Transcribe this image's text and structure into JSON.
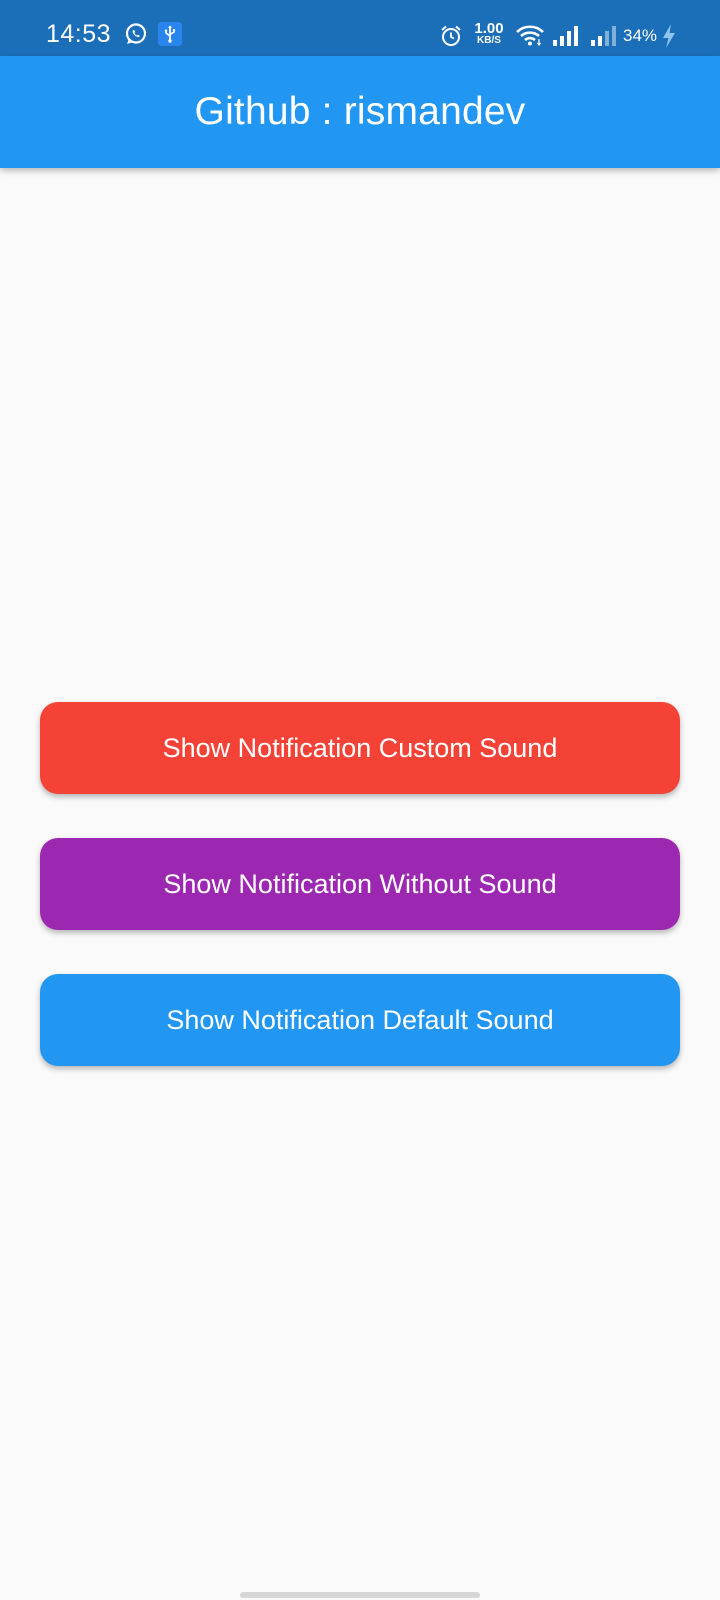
{
  "status_bar": {
    "time": "14:53",
    "speed_value": "1.00",
    "speed_unit": "KB/S",
    "battery": "34%",
    "icons": [
      "whatsapp-icon",
      "usb-icon",
      "alarm-icon",
      "wifi-icon",
      "signal-icon",
      "signal-icon",
      "charging-icon"
    ]
  },
  "app_bar": {
    "title": "Github : rismandev"
  },
  "buttons": {
    "custom_sound": "Show Notification Custom Sound",
    "without_sound": "Show Notification Without Sound",
    "default_sound": "Show Notification Default Sound"
  },
  "colors": {
    "status_bar": "#1b6fb8",
    "app_bar": "#2196f3",
    "background": "#fafafa",
    "custom_button": "#f44336",
    "without_button": "#9c27b0",
    "default_button": "#2196f3"
  }
}
